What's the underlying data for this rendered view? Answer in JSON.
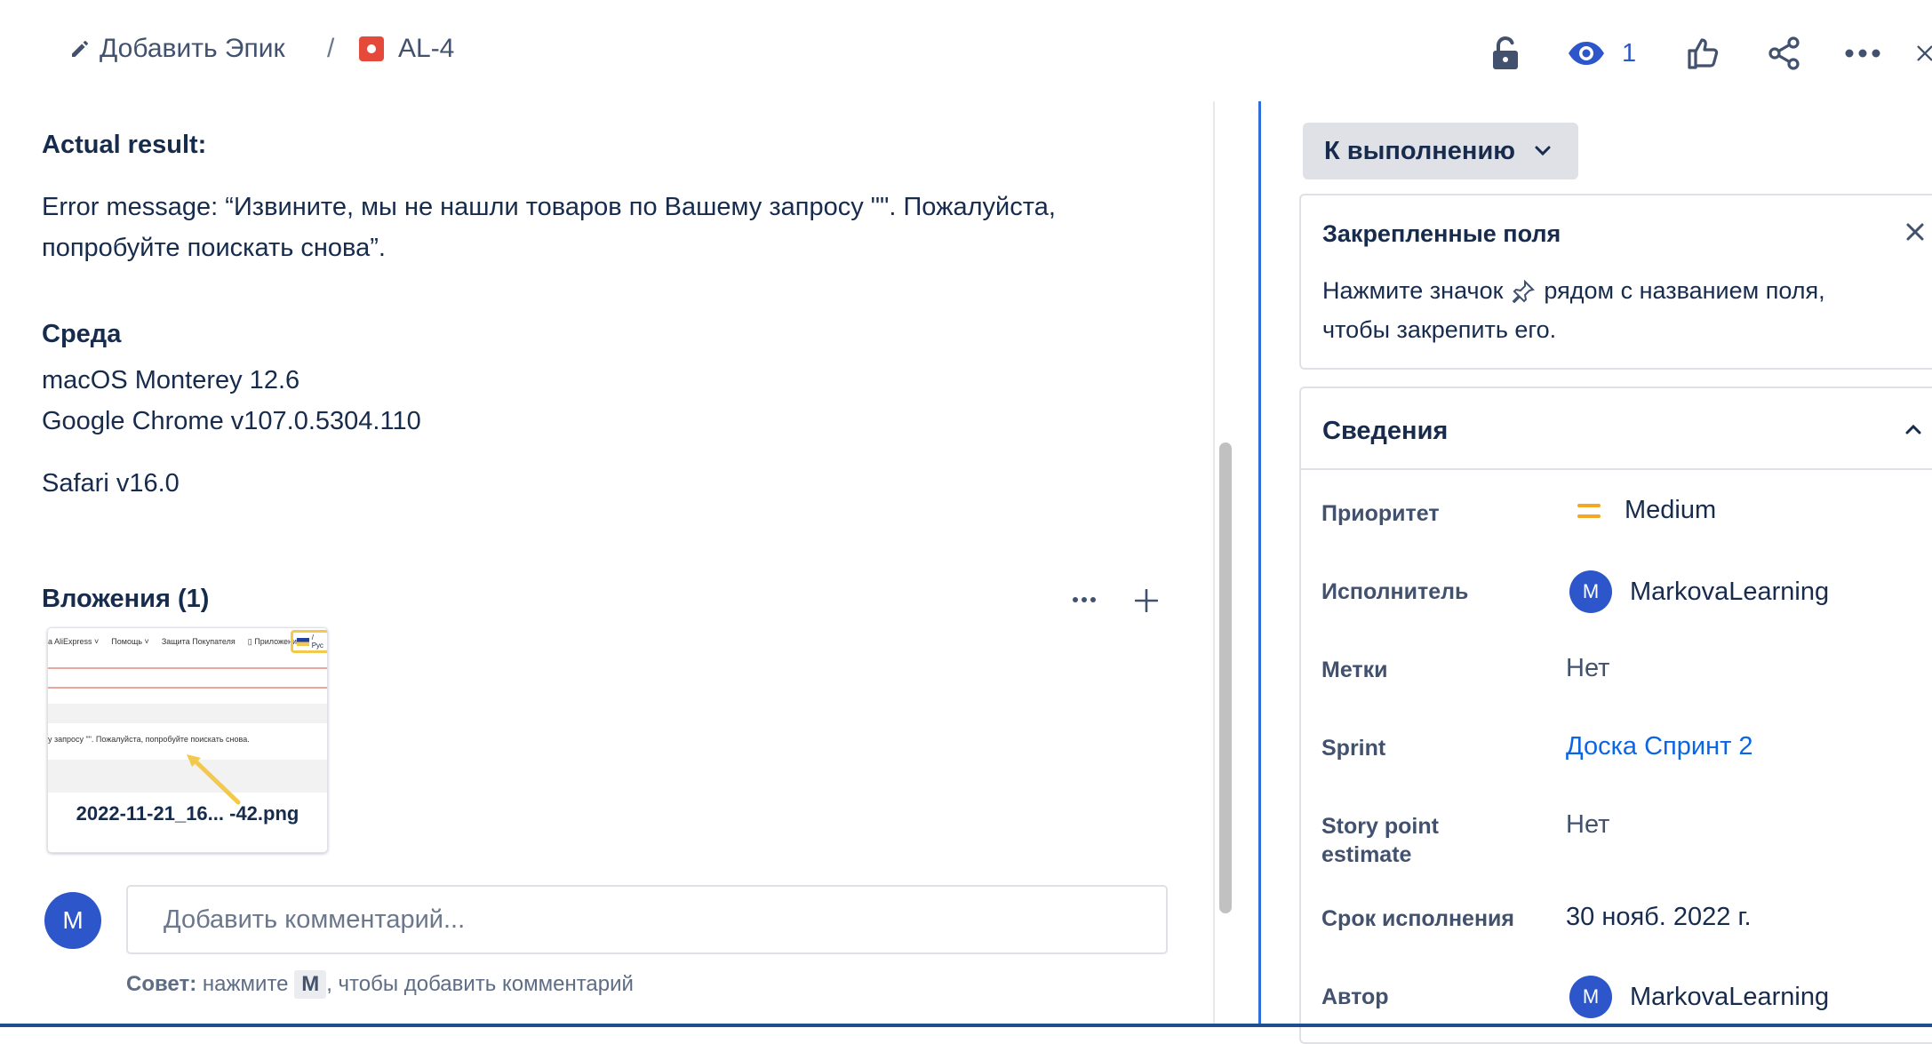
{
  "header": {
    "add_epic_label": "Добавить Эпик",
    "separator": "/",
    "issue_key": "AL-4",
    "watchers_count": "1"
  },
  "description": {
    "actual_result_heading": "Actual result:",
    "error_line_1": "Error message: “Извините, мы не нашли товаров по Вашему запросу \"\". Пожалуйста,",
    "error_line_2": "попробуйте поискать снова”.",
    "env_heading": "Среда",
    "env_lines": [
      "macOS Monterey 12.6",
      "Google Chrome v107.0.5304.110",
      "Safari v16.0"
    ]
  },
  "attachments": {
    "heading": "Вложения (1)",
    "file_name": "2022-11-21_16... -42.png",
    "preview": {
      "nav_items": [
        "a AliExpress ˅",
        "Помощь ˅",
        "Защита Покупателя",
        "▯ Приложение",
        "/ Рус"
      ],
      "message": "у запросу \"\". Пожалуйста, попробуйте поискать снова."
    }
  },
  "comment": {
    "avatar_letter": "M",
    "placeholder": "Добавить комментарий...",
    "tip_bold": "Совет:",
    "tip_pre": " нажмите ",
    "tip_key": "M",
    "tip_post": ", чтобы добавить комментарий"
  },
  "side": {
    "status_label": "К выполнению",
    "pinned": {
      "title": "Закрепленные поля",
      "text_1_pre": "Нажмите значок",
      "text_1_post": "рядом с названием поля,",
      "text_2": "чтобы закрепить его."
    },
    "details": {
      "title": "Сведения",
      "fields": [
        {
          "label": "Приоритет",
          "value": "Medium"
        },
        {
          "label": "Исполнитель",
          "value": "MarkovaLearning",
          "avatar": "M"
        },
        {
          "label": "Метки",
          "value": "Нет"
        },
        {
          "label": "Sprint",
          "value": "Доска Спринт 2"
        },
        {
          "label_1": "Story point",
          "label_2": "estimate",
          "value": "Нет"
        },
        {
          "label": "Срок исполнения",
          "value": "30 нояб. 2022 г."
        },
        {
          "label": "Автор",
          "value": "MarkovaLearning",
          "avatar": "M"
        }
      ]
    }
  },
  "colors": {
    "link": "#0c66e4",
    "priority_medium": "#f5a623",
    "avatar": "#2c56c9",
    "issue_type_bug": "#e5493a"
  }
}
